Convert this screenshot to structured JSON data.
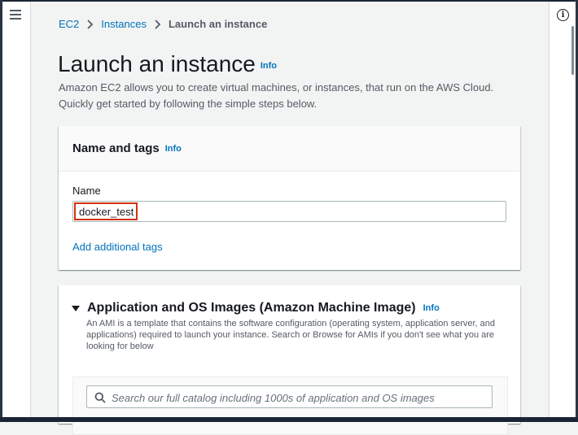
{
  "breadcrumb": {
    "items": [
      "EC2",
      "Instances"
    ],
    "current": "Launch an instance"
  },
  "page": {
    "title": "Launch an instance",
    "info": "Info",
    "description": "Amazon EC2 allows you to create virtual machines, or instances, that run on the AWS Cloud. Quickly get started by following the simple steps below."
  },
  "name_tags": {
    "title": "Name and tags",
    "info": "Info",
    "name_label": "Name",
    "name_value": "docker_test",
    "add_tags": "Add additional tags"
  },
  "ami": {
    "title": "Application and OS Images (Amazon Machine Image)",
    "info": "Info",
    "description": "An AMI is a template that contains the software configuration (operating system, application server, and applications) required to launch your instance. Search or Browse for AMIs if you don't see what you are looking for below",
    "search_placeholder": "Search our full catalog including 1000s of application and OS images"
  },
  "colors": {
    "link": "#0073bb",
    "highlight": "#d13212",
    "background": "#f2f3f3"
  },
  "icons": [
    "menu-icon",
    "info-circle-icon",
    "chevron-right-icon",
    "caret-down-icon",
    "search-icon"
  ]
}
